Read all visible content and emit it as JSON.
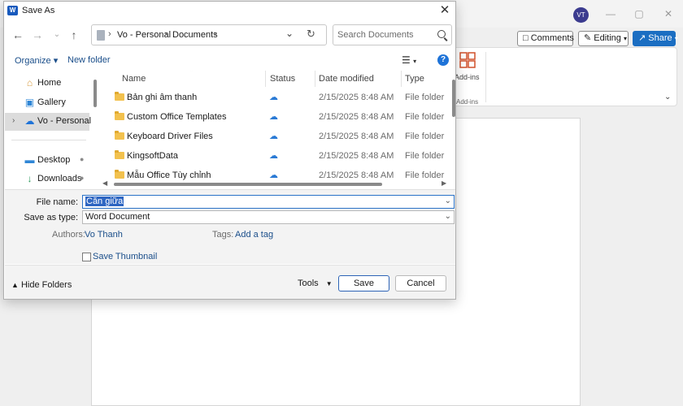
{
  "word": {
    "user_initials": "VT",
    "comments_label": "Comments",
    "editing_label": "Editing",
    "share_label": "Share",
    "addins_label": "Add-ins",
    "addins_group": "Add-ins"
  },
  "dialog": {
    "title": "Save As",
    "app_icon_letter": "W",
    "breadcrumbs": [
      "Vo - Personal",
      "Documents"
    ],
    "search_placeholder": "Search Documents",
    "organize_label": "Organize ▾",
    "new_folder_label": "New folder",
    "nav_items": [
      {
        "label": "Home",
        "icon": "home-icon",
        "glyph": "⌂"
      },
      {
        "label": "Gallery",
        "icon": "gallery-icon",
        "glyph": "▣"
      },
      {
        "label": "Vo - Personal",
        "icon": "onedrive-icon",
        "glyph": "☁"
      },
      {
        "label": "Desktop",
        "icon": "desktop-icon",
        "glyph": "▬"
      },
      {
        "label": "Downloads",
        "icon": "download-icon",
        "glyph": "↓"
      }
    ],
    "columns": {
      "name": "Name",
      "status": "Status",
      "date": "Date modified",
      "type": "Type"
    },
    "files": [
      {
        "name": "Bản ghi âm thanh",
        "status": "cloud-icon",
        "date": "2/15/2025 8:48 AM",
        "type": "File folder"
      },
      {
        "name": "Custom Office Templates",
        "status": "cloud-icon",
        "date": "2/15/2025 8:48 AM",
        "type": "File folder"
      },
      {
        "name": "Keyboard Driver Files",
        "status": "cloud-icon",
        "date": "2/15/2025 8:48 AM",
        "type": "File folder"
      },
      {
        "name": "KingsoftData",
        "status": "cloud-icon",
        "date": "2/15/2025 8:48 AM",
        "type": "File folder"
      },
      {
        "name": "Mẫu Office Tùy chỉnh",
        "status": "cloud-icon",
        "date": "2/15/2025 8:48 AM",
        "type": "File folder"
      }
    ],
    "form": {
      "file_name_label": "File name:",
      "file_name_value": "Căn giữa",
      "save_type_label": "Save as type:",
      "save_type_value": "Word Document",
      "authors_label": "Authors:",
      "authors_value": "Vo Thanh",
      "tags_label": "Tags:",
      "tags_value": "Add a tag",
      "thumbnail_label": "Save Thumbnail"
    },
    "footer": {
      "hide_folders": "Hide Folders",
      "tools": "Tools",
      "save": "Save",
      "cancel": "Cancel"
    }
  }
}
